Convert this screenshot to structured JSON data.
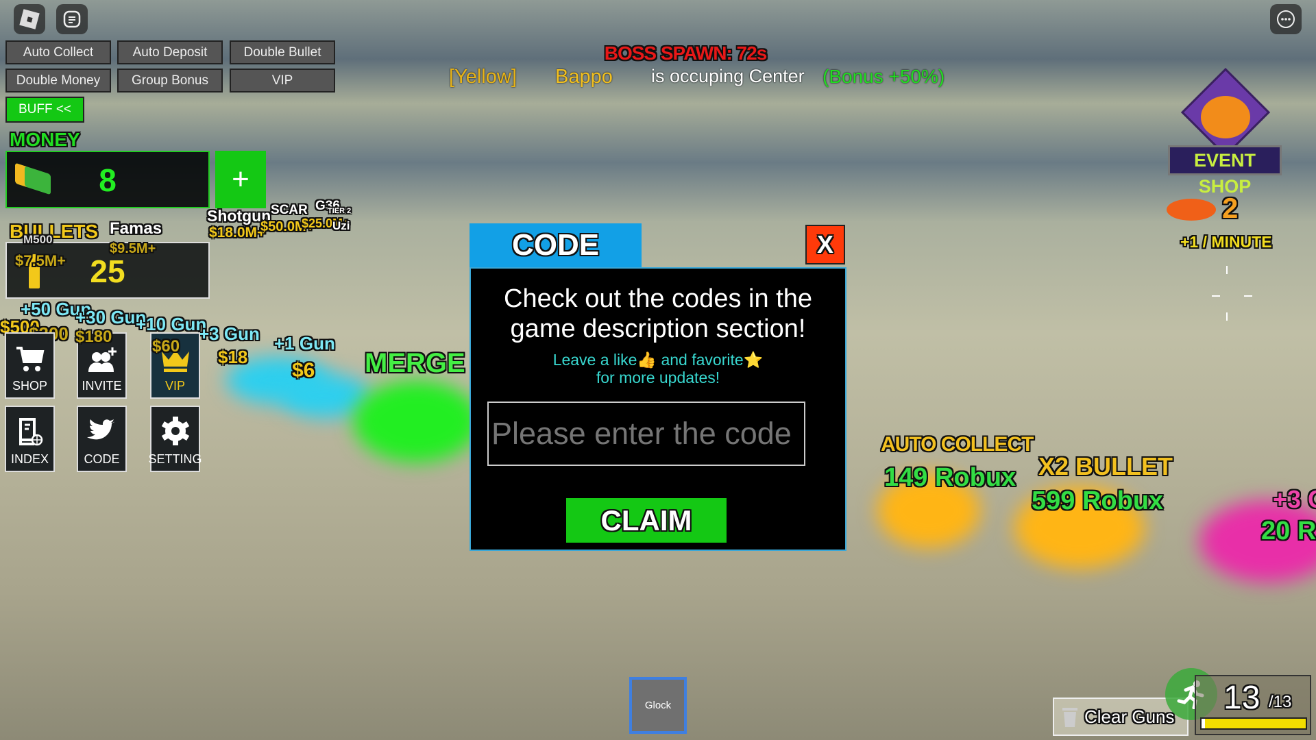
{
  "topbar": {
    "roblox_icon": "roblox-logo",
    "chat_icon": "chat-icon",
    "menu_icon": "more-icon"
  },
  "buff_buttons": [
    "Auto Collect",
    "Auto Deposit",
    "Double Bullet",
    "Double Money",
    "Group Bonus",
    "VIP"
  ],
  "buff_toggle": "BUFF <<",
  "money": {
    "label": "MONEY",
    "value": "8",
    "add_label": "+"
  },
  "bullets": {
    "label": "BULLETS",
    "value": "25"
  },
  "menu_tiles": [
    {
      "label": "SHOP",
      "icon": "cart-icon"
    },
    {
      "label": "INVITE",
      "icon": "invite-icon"
    },
    {
      "label": "VIP",
      "icon": "crown-icon"
    },
    {
      "label": "INDEX",
      "icon": "index-book-icon"
    },
    {
      "label": "CODE",
      "icon": "twitter-bird-icon"
    },
    {
      "label": "SETTING",
      "icon": "gear-icon"
    }
  ],
  "announcement": {
    "boss": "BOSS SPAWN: 72s",
    "team": "[Yellow]",
    "player": "Bappo",
    "message": "is occuping Center",
    "bonus": "(Bonus +50%)"
  },
  "world_labels": {
    "guns": [
      {
        "name": "Shotgun",
        "price": "$18.0M+"
      },
      {
        "name": "SCAR",
        "price": "$50.0M+"
      },
      {
        "name": "G36",
        "price": "$25.0M+"
      },
      {
        "name": "Uzi",
        "price": "TIER 2"
      },
      {
        "name": "Famas",
        "price": "$9.5M+"
      },
      {
        "name": "M500",
        "price": "$7.5M+"
      }
    ],
    "upgrades": [
      {
        "name": "+50 Gun",
        "price": "$500"
      },
      {
        "name": "+30 Gun",
        "price": "$300"
      },
      {
        "name": "+10 Gun",
        "price": "$180"
      },
      {
        "name": "+3 Gun",
        "price": "$60"
      },
      {
        "name": "+3 Gun",
        "price": "$18"
      },
      {
        "name": "+1 Gun",
        "price": "$6"
      }
    ],
    "merge": "MERGE",
    "shop_pads": [
      {
        "name": "AUTO COLLECT",
        "price": "149 Robux"
      },
      {
        "name": "X2 BULLET",
        "price": "599 Robux"
      },
      {
        "name": "+3 G",
        "price": "20 R"
      }
    ]
  },
  "event_shop": {
    "label": "EVENT SHOP",
    "candy_count": "2",
    "rate": "+1 / MINUTE"
  },
  "code_modal": {
    "tab": "CODE",
    "close": "X",
    "heading": "Check out the codes in the game description section!",
    "sub1": "Leave a like👍 and favorite⭐",
    "sub2": "for more updates!",
    "placeholder": "Please enter the code",
    "value": "",
    "claim": "CLAIM"
  },
  "hotbar": {
    "slot1": "Glock"
  },
  "clear_guns": "Clear Guns",
  "capacity": {
    "current": "13",
    "max": "/13",
    "fill_fraction": 0.97
  },
  "colors": {
    "accent_green": "#14c814",
    "modal_tab": "#12a0e6",
    "close": "#ff3a0a",
    "money_text": "#22ee22",
    "bullet_text": "#f2dd20"
  }
}
